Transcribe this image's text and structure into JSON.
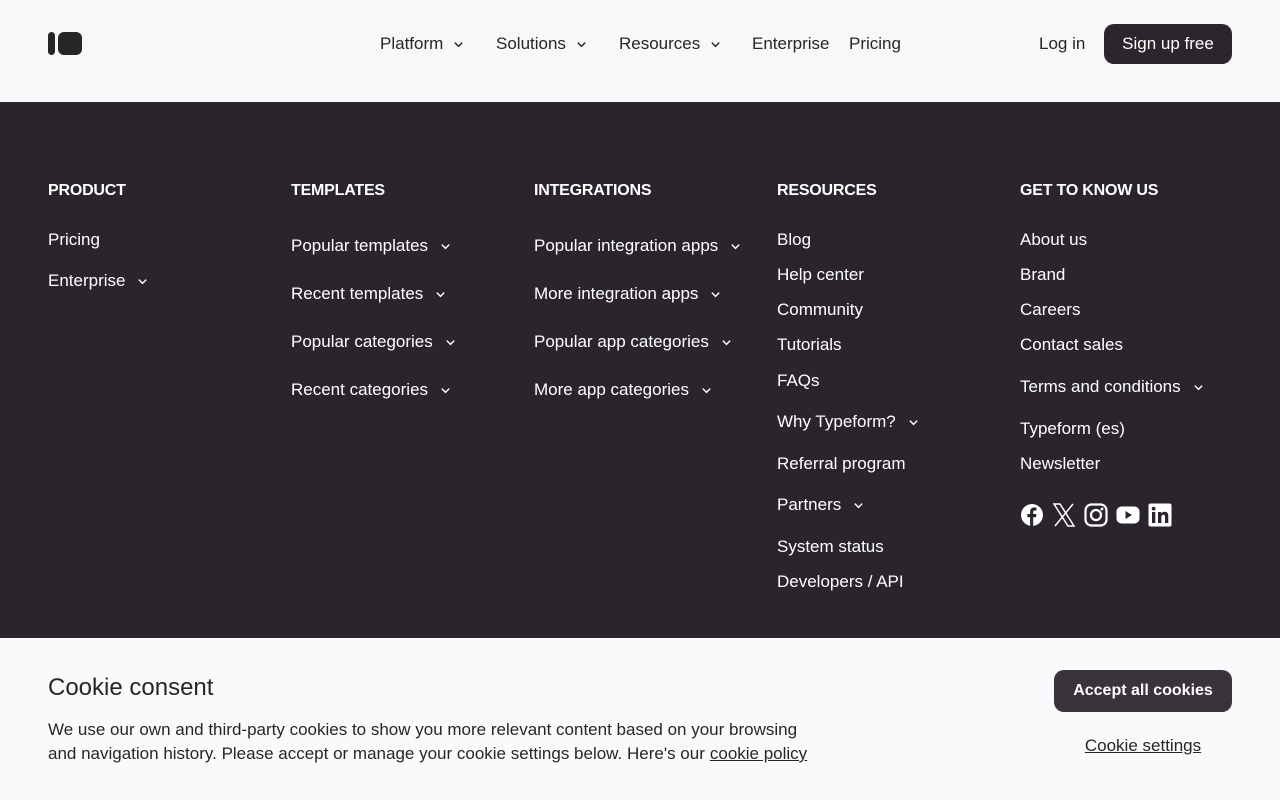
{
  "header": {
    "nav": [
      {
        "label": "Platform",
        "has_dropdown": true
      },
      {
        "label": "Solutions",
        "has_dropdown": true
      },
      {
        "label": "Resources",
        "has_dropdown": true
      },
      {
        "label": "Enterprise",
        "has_dropdown": false
      },
      {
        "label": "Pricing",
        "has_dropdown": false
      }
    ],
    "login_label": "Log in",
    "signup_label": "Sign up free"
  },
  "footer": {
    "columns": [
      {
        "title": "PRODUCT",
        "links": [
          {
            "label": "Pricing",
            "has_dropdown": false
          },
          {
            "label": "Enterprise",
            "has_dropdown": true
          }
        ]
      },
      {
        "title": "TEMPLATES",
        "links": [
          {
            "label": "Popular templates",
            "has_dropdown": true
          },
          {
            "label": "Recent templates",
            "has_dropdown": true
          },
          {
            "label": "Popular categories",
            "has_dropdown": true
          },
          {
            "label": "Recent categories",
            "has_dropdown": true
          }
        ]
      },
      {
        "title": "INTEGRATIONS",
        "links": [
          {
            "label": "Popular integration apps",
            "has_dropdown": true
          },
          {
            "label": "More integration apps",
            "has_dropdown": true
          },
          {
            "label": "Popular app categories",
            "has_dropdown": true
          },
          {
            "label": "More app categories",
            "has_dropdown": true
          }
        ]
      },
      {
        "title": "RESOURCES",
        "links": [
          {
            "label": "Blog",
            "has_dropdown": false
          },
          {
            "label": "Help center",
            "has_dropdown": false
          },
          {
            "label": "Community",
            "has_dropdown": false
          },
          {
            "label": "Tutorials",
            "has_dropdown": false
          },
          {
            "label": "FAQs",
            "has_dropdown": false
          },
          {
            "label": "Why Typeform?",
            "has_dropdown": true
          },
          {
            "label": "Referral program",
            "has_dropdown": false
          },
          {
            "label": "Partners",
            "has_dropdown": true
          },
          {
            "label": "System status",
            "has_dropdown": false
          },
          {
            "label": "Developers / API",
            "has_dropdown": false
          }
        ]
      },
      {
        "title": "GET TO KNOW US",
        "links": [
          {
            "label": "About us",
            "has_dropdown": false
          },
          {
            "label": "Brand",
            "has_dropdown": false
          },
          {
            "label": "Careers",
            "has_dropdown": false
          },
          {
            "label": "Contact sales",
            "has_dropdown": false
          },
          {
            "label": "Terms and conditions",
            "has_dropdown": true
          },
          {
            "label": "Typeform (es)",
            "has_dropdown": false
          },
          {
            "label": "Newsletter",
            "has_dropdown": false
          }
        ]
      }
    ],
    "social_icons": [
      "facebook-icon",
      "x-icon",
      "instagram-icon",
      "youtube-icon",
      "linkedin-icon"
    ]
  },
  "cookie": {
    "title": "Cookie consent",
    "text": "We use our own and third-party cookies to show you more relevant content based on your browsing and navigation history. Please accept or manage your cookie settings below. Here's our",
    "policy_link": "cookie policy",
    "accept_label": "Accept all cookies",
    "settings_label": "Cookie settings"
  },
  "colors": {
    "footer_bg": "#2a252c",
    "header_bg": "#f8f8fa",
    "primary_button": "#2b252c",
    "text": "#262627"
  }
}
